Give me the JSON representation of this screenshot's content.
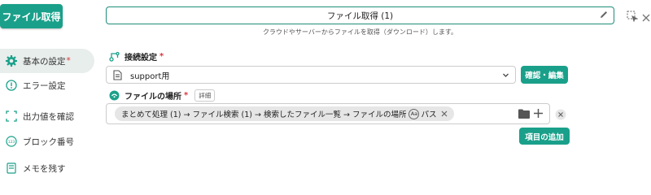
{
  "action_button": {
    "label": "ファイル取得"
  },
  "sidebar": {
    "items": [
      {
        "label": "基本の設定",
        "required": "*"
      },
      {
        "label": "エラー設定"
      },
      {
        "label": "出力値を確認"
      },
      {
        "label": "ブロック番号"
      },
      {
        "label": "メモを残す"
      }
    ]
  },
  "title": {
    "value": "ファイル取得 (1)",
    "hint": "クラウドやサーバーからファイルを取得（ダウンロード）します。"
  },
  "connection": {
    "label": "接続設定",
    "required": "*",
    "selected": "support用",
    "confirm_button": "確認・編集"
  },
  "file_location": {
    "label": "ファイルの場所",
    "required": "*",
    "detail_badge": "詳細",
    "path_chip": "まとめて処理 (1) → ファイル検索 (1) → 検索したファイル一覧 → ファイルの場所",
    "aa_badge": "Aa",
    "path_suffix": "パス",
    "add_item_button": "項目の追加"
  },
  "colors": {
    "accent": "#1aa08a",
    "required": "#d9363e"
  }
}
